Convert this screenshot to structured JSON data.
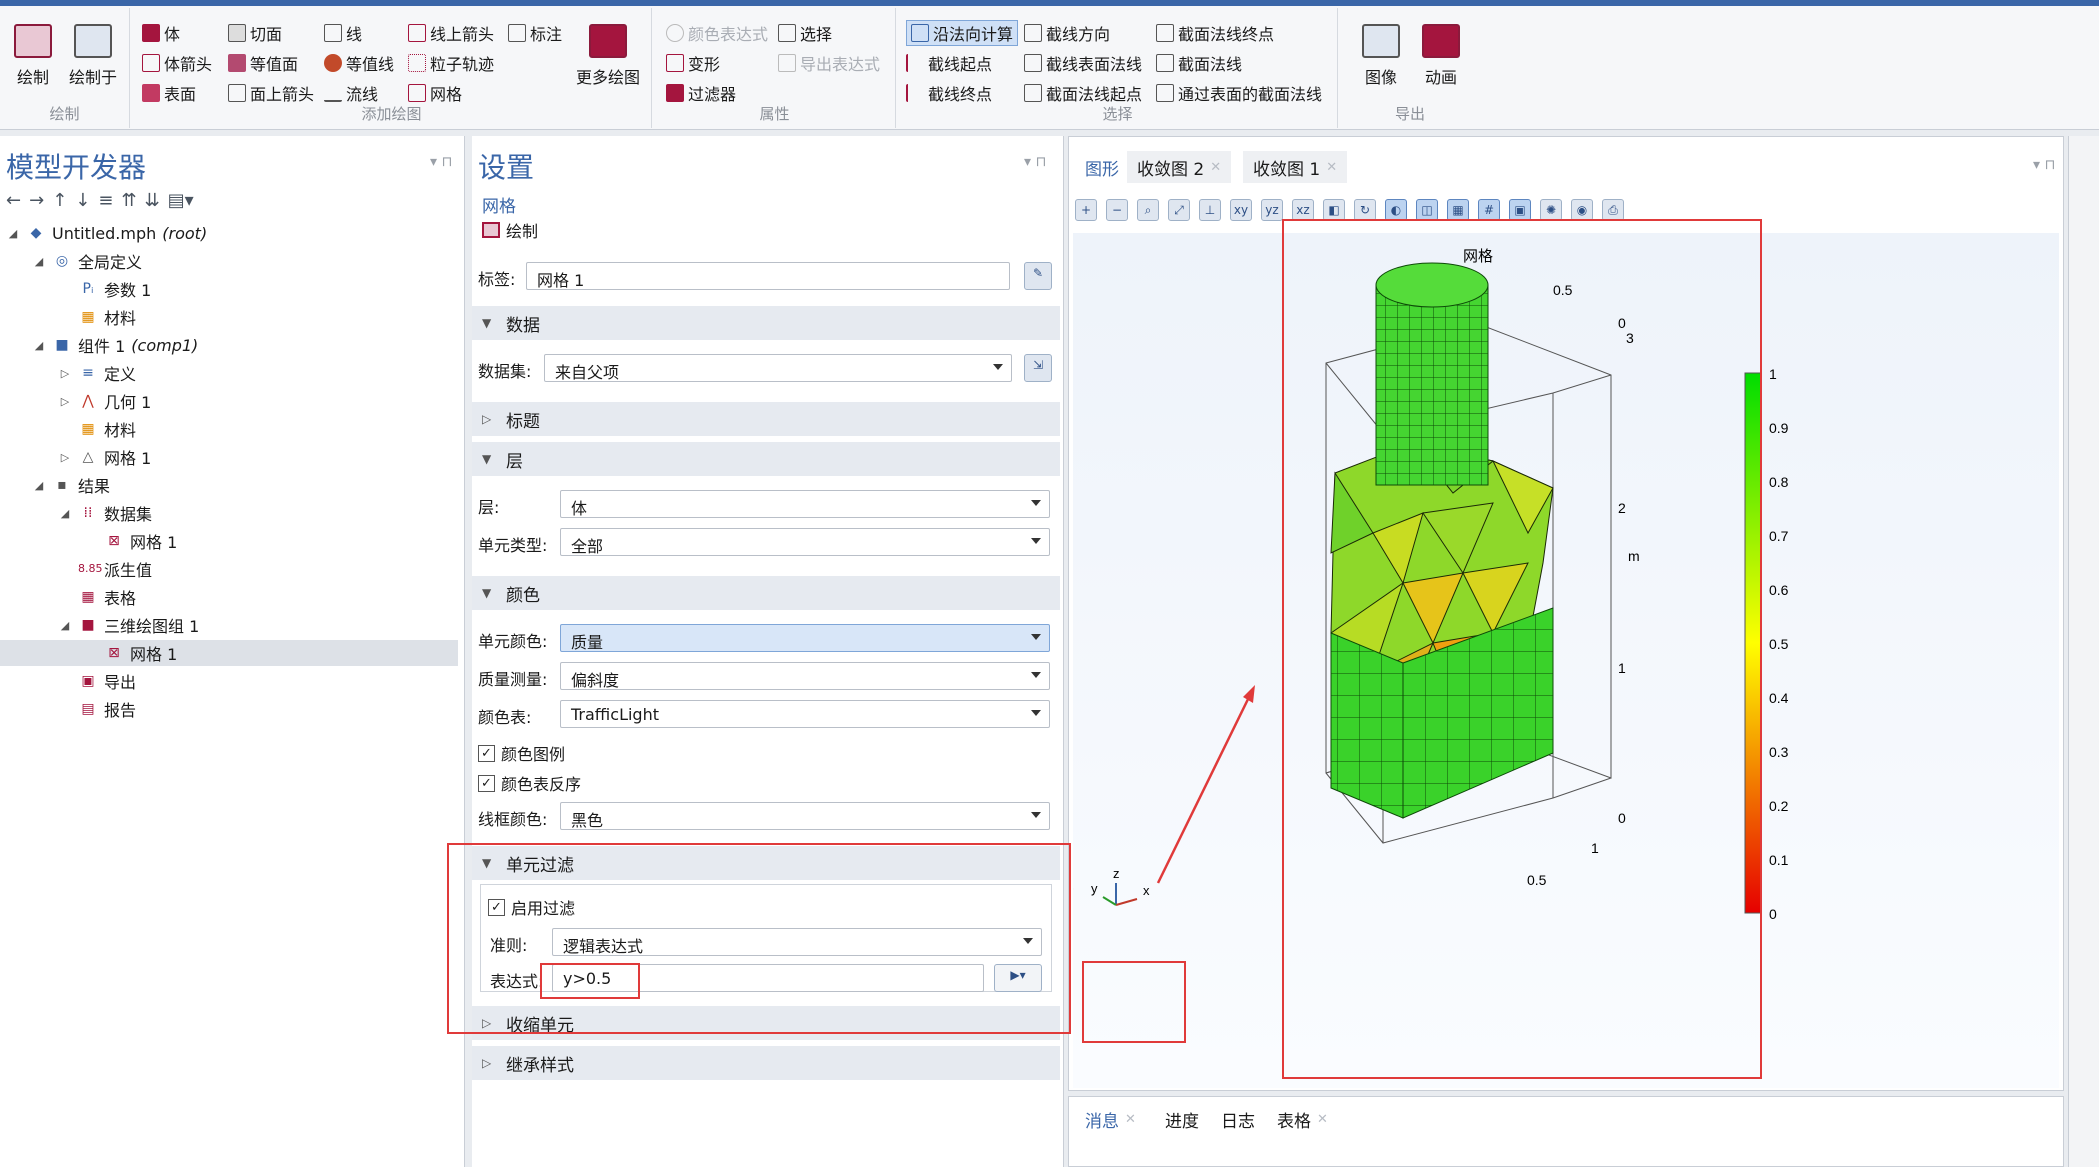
{
  "ribbon": {
    "groups": [
      {
        "label": "绘制"
      },
      {
        "label": "添加绘图"
      },
      {
        "label": "属性"
      },
      {
        "label": "选择"
      },
      {
        "label": "导出"
      }
    ],
    "plot": {
      "draw": "绘制",
      "draw_in": "绘制于"
    },
    "add_plot": {
      "volume": "体",
      "slice": "切面",
      "line": "线",
      "line_arrow": "线上箭头",
      "annotation": "标注",
      "volume_arrow": "体箭头",
      "isosurface": "等值面",
      "contour": "等值线",
      "particle_traj": "粒子轨迹",
      "surface": "表面",
      "surface_arrow": "面上箭头",
      "streamline": "流线",
      "mesh": "网格",
      "more": "更多绘图"
    },
    "attributes": {
      "color_expr": "颜色表达式",
      "select": "选择",
      "deform": "变形",
      "export_expr": "导出表达式",
      "filter": "过滤器"
    },
    "selection": {
      "normal_compute": "沿法向计算",
      "cut_direction": "截线方向",
      "cut_normal_end": "截面法线终点",
      "cut_start": "截线起点",
      "cut_surface_normal": "截线表面法线",
      "cut_plane_normal": "截面法线",
      "cut_end": "截线终点",
      "cut_plane_normal_start": "截面法线起点",
      "normal_through_surface": "通过表面的截面法线"
    },
    "export": {
      "image": "图像",
      "animation": "动画"
    }
  },
  "model_builder": {
    "title": "模型开发器",
    "tree": [
      {
        "label": "Untitled.mph",
        "suffix": "(root)"
      },
      {
        "label": "全局定义"
      },
      {
        "label": "参数 1"
      },
      {
        "label": "材料"
      },
      {
        "label": "组件 1",
        "suffix": "(comp1)"
      },
      {
        "label": "定义"
      },
      {
        "label": "几何 1"
      },
      {
        "label": "材料"
      },
      {
        "label": "网格 1"
      },
      {
        "label": "结果"
      },
      {
        "label": "数据集"
      },
      {
        "label": "网格 1"
      },
      {
        "label": "派生值"
      },
      {
        "label": "表格"
      },
      {
        "label": "三维绘图组 1"
      },
      {
        "label": "网格 1"
      },
      {
        "label": "导出"
      },
      {
        "label": "报告"
      }
    ]
  },
  "settings": {
    "title": "设置",
    "subtitle": "网格",
    "plot_button": "绘制",
    "label_caption": "标签:",
    "label_value": "网格 1",
    "sections": {
      "data": "数据",
      "title": "标题",
      "level": "层",
      "color": "颜色",
      "element_filter": "单元过滤",
      "shrink": "收缩单元",
      "inherit": "继承样式"
    },
    "dataset_caption": "数据集:",
    "dataset_value": "来自父项",
    "level_caption": "层:",
    "level_value": "体",
    "elem_type_caption": "单元类型:",
    "elem_type_value": "全部",
    "elem_color_caption": "单元颜色:",
    "elem_color_value": "质量",
    "quality_caption": "质量测量:",
    "quality_value": "偏斜度",
    "colortable_caption": "颜色表:",
    "colortable_value": "TrafficLight",
    "color_legend": "颜色图例",
    "reverse_colortable": "颜色表反序",
    "wire_color_caption": "线框颜色:",
    "wire_color_value": "黑色",
    "enable_filter": "启用过滤",
    "criterion_caption": "准则:",
    "criterion_value": "逻辑表达式",
    "expression_caption": "表达式:",
    "expression_value": "y>0.5"
  },
  "graphics": {
    "tabs": [
      {
        "label": "图形"
      },
      {
        "label": "收敛图 2"
      },
      {
        "label": "收敛图 1"
      }
    ],
    "plot_title": "网格",
    "axis_unit": "m",
    "axes": {
      "z": "z",
      "y": "y",
      "x": "x"
    },
    "ticks_z": [
      "0",
      "1",
      "2",
      "3"
    ],
    "ticks_y_top": [
      "0.5",
      "0"
    ],
    "ticks_bottom": [
      "1",
      "0.5"
    ],
    "colorbar": {
      "max": "1",
      "labels": [
        "0.9",
        "0.8",
        "0.7",
        "0.6",
        "0.5",
        "0.4",
        "0.3",
        "0.2",
        "0.1",
        "0"
      ],
      "min_color": "#e60000",
      "mid_color": "#ffff00",
      "max_color": "#00dd00"
    }
  },
  "bottom": {
    "tabs": [
      {
        "label": "消息"
      },
      {
        "label": "进度"
      },
      {
        "label": "日志"
      },
      {
        "label": "表格"
      }
    ]
  },
  "colors": {
    "accent": "#3a66a8",
    "annotation_red": "#e03a3a"
  }
}
